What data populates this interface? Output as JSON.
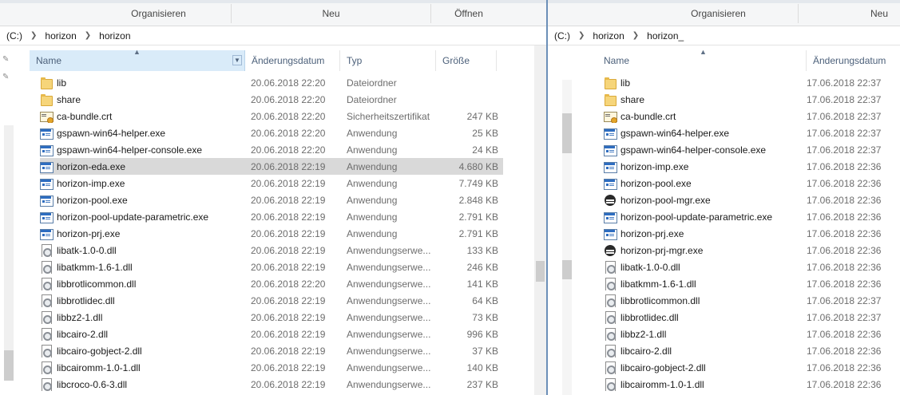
{
  "left": {
    "ribbon": {
      "groups": [
        "Organisieren",
        "Neu",
        "Öffnen"
      ]
    },
    "address": {
      "crumbs": [
        "(C:)",
        "horizon",
        "horizon"
      ]
    },
    "columns": {
      "name": "Name",
      "date": "Änderungsdatum",
      "type": "Typ",
      "size": "Größe"
    },
    "files": [
      {
        "name": "lib",
        "date": "20.06.2018 22:20",
        "type": "Dateiordner",
        "size": "",
        "icon": "folder-icon"
      },
      {
        "name": "share",
        "date": "20.06.2018 22:20",
        "type": "Dateiordner",
        "size": "",
        "icon": "folder-icon"
      },
      {
        "name": "ca-bundle.crt",
        "date": "20.06.2018 22:20",
        "type": "Sicherheitszertifikat",
        "size": "247 KB",
        "icon": "certificate-icon"
      },
      {
        "name": "gspawn-win64-helper.exe",
        "date": "20.06.2018 22:20",
        "type": "Anwendung",
        "size": "25 KB",
        "icon": "exe-icon"
      },
      {
        "name": "gspawn-win64-helper-console.exe",
        "date": "20.06.2018 22:20",
        "type": "Anwendung",
        "size": "24 KB",
        "icon": "exe-icon"
      },
      {
        "name": "horizon-eda.exe",
        "date": "20.06.2018 22:19",
        "type": "Anwendung",
        "size": "4.680 KB",
        "icon": "exe-icon",
        "selected": true
      },
      {
        "name": "horizon-imp.exe",
        "date": "20.06.2018 22:19",
        "type": "Anwendung",
        "size": "7.749 KB",
        "icon": "exe-icon"
      },
      {
        "name": "horizon-pool.exe",
        "date": "20.06.2018 22:19",
        "type": "Anwendung",
        "size": "2.848 KB",
        "icon": "exe-icon"
      },
      {
        "name": "horizon-pool-update-parametric.exe",
        "date": "20.06.2018 22:19",
        "type": "Anwendung",
        "size": "2.791 KB",
        "icon": "exe-icon"
      },
      {
        "name": "horizon-prj.exe",
        "date": "20.06.2018 22:19",
        "type": "Anwendung",
        "size": "2.791 KB",
        "icon": "exe-icon"
      },
      {
        "name": "libatk-1.0-0.dll",
        "date": "20.06.2018 22:19",
        "type": "Anwendungserwe...",
        "size": "133 KB",
        "icon": "dll-icon"
      },
      {
        "name": "libatkmm-1.6-1.dll",
        "date": "20.06.2018 22:19",
        "type": "Anwendungserwe...",
        "size": "246 KB",
        "icon": "dll-icon"
      },
      {
        "name": "libbrotlicommon.dll",
        "date": "20.06.2018 22:20",
        "type": "Anwendungserwe...",
        "size": "141 KB",
        "icon": "dll-icon"
      },
      {
        "name": "libbrotlidec.dll",
        "date": "20.06.2018 22:19",
        "type": "Anwendungserwe...",
        "size": "64 KB",
        "icon": "dll-icon"
      },
      {
        "name": "libbz2-1.dll",
        "date": "20.06.2018 22:19",
        "type": "Anwendungserwe...",
        "size": "73 KB",
        "icon": "dll-icon"
      },
      {
        "name": "libcairo-2.dll",
        "date": "20.06.2018 22:19",
        "type": "Anwendungserwe...",
        "size": "996 KB",
        "icon": "dll-icon"
      },
      {
        "name": "libcairo-gobject-2.dll",
        "date": "20.06.2018 22:19",
        "type": "Anwendungserwe...",
        "size": "37 KB",
        "icon": "dll-icon"
      },
      {
        "name": "libcairomm-1.0-1.dll",
        "date": "20.06.2018 22:19",
        "type": "Anwendungserwe...",
        "size": "140 KB",
        "icon": "dll-icon"
      },
      {
        "name": "libcroco-0.6-3.dll",
        "date": "20.06.2018 22:19",
        "type": "Anwendungserwe...",
        "size": "237 KB",
        "icon": "dll-icon"
      }
    ]
  },
  "right": {
    "ribbon": {
      "groups": [
        "Organisieren",
        "Neu"
      ]
    },
    "address": {
      "crumbs": [
        "(C:)",
        "horizon",
        "horizon_"
      ]
    },
    "columns": {
      "name": "Name",
      "date": "Änderungsdatum"
    },
    "files": [
      {
        "name": "lib",
        "date": "17.06.2018 22:37",
        "icon": "folder-icon"
      },
      {
        "name": "share",
        "date": "17.06.2018 22:37",
        "icon": "folder-icon"
      },
      {
        "name": "ca-bundle.crt",
        "date": "17.06.2018 22:37",
        "icon": "certificate-icon"
      },
      {
        "name": "gspawn-win64-helper.exe",
        "date": "17.06.2018 22:37",
        "icon": "exe-icon"
      },
      {
        "name": "gspawn-win64-helper-console.exe",
        "date": "17.06.2018 22:37",
        "icon": "exe-icon"
      },
      {
        "name": "horizon-imp.exe",
        "date": "17.06.2018 22:36",
        "icon": "exe-icon"
      },
      {
        "name": "horizon-pool.exe",
        "date": "17.06.2018 22:36",
        "icon": "exe-icon"
      },
      {
        "name": "horizon-pool-mgr.exe",
        "date": "17.06.2018 22:36",
        "icon": "app-mgr-icon"
      },
      {
        "name": "horizon-pool-update-parametric.exe",
        "date": "17.06.2018 22:36",
        "icon": "exe-icon"
      },
      {
        "name": "horizon-prj.exe",
        "date": "17.06.2018 22:36",
        "icon": "exe-icon"
      },
      {
        "name": "horizon-prj-mgr.exe",
        "date": "17.06.2018 22:36",
        "icon": "app-mgr-icon"
      },
      {
        "name": "libatk-1.0-0.dll",
        "date": "17.06.2018 22:36",
        "icon": "dll-icon"
      },
      {
        "name": "libatkmm-1.6-1.dll",
        "date": "17.06.2018 22:36",
        "icon": "dll-icon"
      },
      {
        "name": "libbrotlicommon.dll",
        "date": "17.06.2018 22:37",
        "icon": "dll-icon"
      },
      {
        "name": "libbrotlidec.dll",
        "date": "17.06.2018 22:37",
        "icon": "dll-icon"
      },
      {
        "name": "libbz2-1.dll",
        "date": "17.06.2018 22:36",
        "icon": "dll-icon"
      },
      {
        "name": "libcairo-2.dll",
        "date": "17.06.2018 22:36",
        "icon": "dll-icon"
      },
      {
        "name": "libcairo-gobject-2.dll",
        "date": "17.06.2018 22:36",
        "icon": "dll-icon"
      },
      {
        "name": "libcairomm-1.0-1.dll",
        "date": "17.06.2018 22:36",
        "icon": "dll-icon"
      }
    ]
  },
  "colors": {
    "selected_row": "#d9d9d9",
    "sorted_header": "#d9ebf9",
    "window_border": "#6b8fb8"
  }
}
